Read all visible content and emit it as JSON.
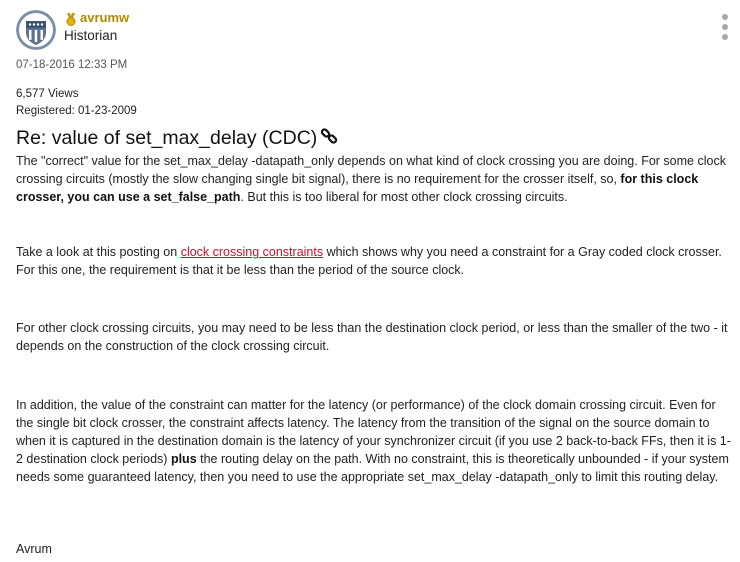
{
  "author": {
    "username": "avrumw",
    "rank": "Historian",
    "avatar_icon": "shield-avatar-icon",
    "rank_icon": "medal-icon",
    "username_color": "#b08a00"
  },
  "post": {
    "date": "07-18-2016 12:33 PM",
    "views": "6,577 Views",
    "registered": "Registered: 01-23-2009",
    "title": "Re: value of set_max_delay (CDC)",
    "p1": {
      "t1": "The \"correct\" value for the set_max_delay -datapath_only depends on what kind of clock crossing you are doing. For some clock crossing circuits (mostly the slow changing single bit signal), there is no requirement for the crosser itself, so, ",
      "b1": "for this clock crosser, you can use a set_false_path",
      "t2": ". But this is too liberal for most other clock crossing circuits."
    },
    "p2": {
      "t1": "Take a look at this posting on ",
      "link": "clock crossing constraints",
      "t2": " which shows why you need a constraint for a Gray coded clock crosser. For this one, the requirement is that it be less than the period of the source clock."
    },
    "p3": "For other clock crossing circuits, you may need to be less than the destination clock period, or less than the smaller of the two - it depends on the construction of the clock crossing circuit.",
    "p4": {
      "t1": "In addition, the value of the constraint can matter for the latency (or performance) of the clock domain crossing circuit. Even for the single bit clock crosser, the constraint affects latency. The latency from the transition of the signal on the source domain to when it is captured in the destination domain is the latency of your synchronizer circuit (if you use 2 back-to-back FFs, then it is 1-2 destination clock periods) ",
      "b1": "plus",
      "t2": " the routing delay on the path. With no constraint, this is theoretically unbounded - if your system needs some guaranteed latency, then you need to use the appropriate set_max_delay -datapath_only to limit this routing delay."
    },
    "signature": "Avrum"
  },
  "colors": {
    "link": "#c8102e",
    "kebab": "#a8a8a8"
  }
}
